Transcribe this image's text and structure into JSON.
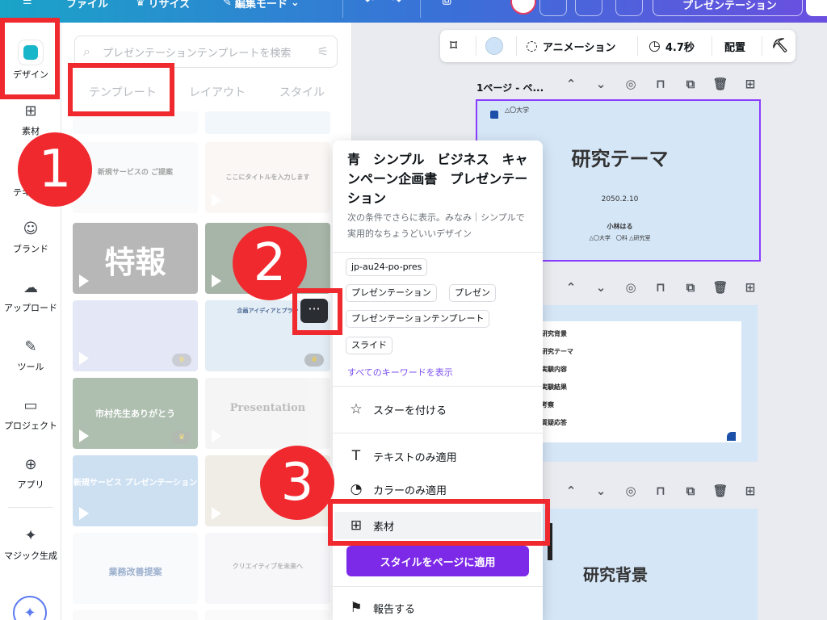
{
  "topbar": {
    "file_label": "ファイル",
    "resize_label": "リサイズ",
    "edit_mode_label": "編集モード",
    "present_label": "プレゼンテーション"
  },
  "rail": {
    "items": [
      {
        "label": "デザイン",
        "icon": "design-icon"
      },
      {
        "label": "素材",
        "icon": "elements-icon"
      },
      {
        "label": "テキスト",
        "icon": "text-icon"
      },
      {
        "label": "ブランド",
        "icon": "brand-icon"
      },
      {
        "label": "アップロード",
        "icon": "upload-icon"
      },
      {
        "label": "ツール",
        "icon": "tools-icon"
      },
      {
        "label": "プロジェクト",
        "icon": "projects-icon"
      },
      {
        "label": "アプリ",
        "icon": "apps-icon"
      },
      {
        "label": "マジック生成",
        "icon": "magic-icon"
      }
    ]
  },
  "panel": {
    "search_placeholder": "プレゼンテーションテンプレートを検索",
    "tabs": [
      "テンプレート",
      "レイアウト",
      "スタイル"
    ],
    "thumbs": [
      {
        "text": "新規サービスの ご提案"
      },
      {
        "text": "ここにタイトルを入力します"
      },
      {
        "text": "特報"
      },
      {
        "text": "企画アイディアとプラン"
      },
      {
        "text": "市村先生ありがとう"
      },
      {
        "text": "Presentation"
      },
      {
        "text": "新規サービス プレゼンテーション"
      },
      {
        "text": "業務改善提案"
      },
      {
        "text": "クリエイティブを未来へ"
      }
    ]
  },
  "toolbar": {
    "animation_label": "アニメーション",
    "duration_label": "4.7秒",
    "position_label": "配置",
    "bg_color": "#cfe3f8"
  },
  "pages": {
    "page1_label": "1ページ - ペ...",
    "slide1": {
      "univ": "△〇大学",
      "title": "研究テーマ",
      "date": "2050.2.10",
      "name": "小林はる",
      "lab": "△〇大学　〇科 △研究室"
    },
    "slide2_items": [
      "研究背景",
      "研究テーマ",
      "実験内容",
      "実験結果",
      "考察",
      "質疑応答"
    ],
    "slide3_title": "研究背景"
  },
  "popup": {
    "title": "青　シンプル　ビジネス　キャンペーン企画書　プレゼンテーション",
    "description": "次の条件でさらに表示。みなみ｜シンプルで実用的なちょうどいいデザイン",
    "keywords": [
      "jp-au24-po-pres",
      "プレゼンテーション",
      "プレゼン",
      "プレゼンテーションテンプレート",
      "スライド"
    ],
    "show_all_keywords": "すべてのキーワードを表示",
    "star_label": "スターを付ける",
    "text_only_label": "テキストのみ適用",
    "color_only_label": "カラーのみ適用",
    "elements_label": "素材",
    "apply_button": "スタイルをページに適用",
    "report_label": "報告する"
  },
  "annotations": [
    "1",
    "2",
    "3"
  ],
  "colors": {
    "accent": "#8b3dff",
    "annotation_red": "#f0292f",
    "apply_purple": "#7d2ae8"
  }
}
